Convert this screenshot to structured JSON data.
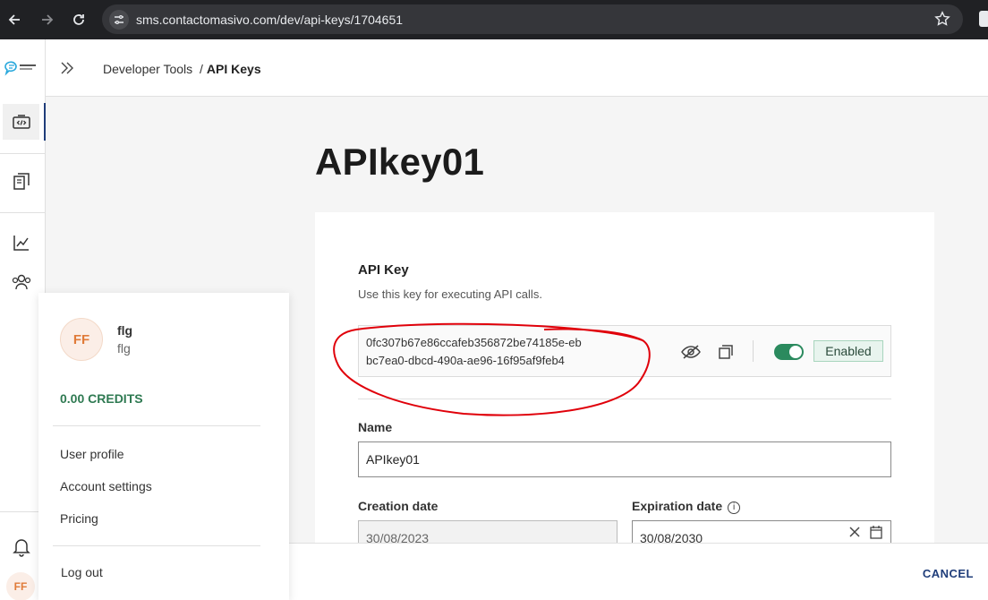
{
  "browser": {
    "url": "sms.contactomasivo.com/dev/api-keys/1704651"
  },
  "header": {
    "breadcrumb_parent": "Developer Tools",
    "breadcrumb_separator": "/",
    "breadcrumb_current": "API Keys"
  },
  "page": {
    "title": "APIkey01"
  },
  "api_key": {
    "section_title": "API Key",
    "section_description": "Use this key for executing API calls.",
    "value_line1": "0fc307b67e86ccafeb356872be74185e-eb",
    "value_line2": "bc7ea0-dbcd-490a-ae96-16f95af9feb4",
    "enabled": true,
    "status_label": "Enabled"
  },
  "form": {
    "name_label": "Name",
    "name_value": "APIkey01",
    "creation_label": "Creation date",
    "creation_value": "30/08/2023",
    "expiration_label": "Expiration date",
    "expiration_value": "30/08/2030"
  },
  "footer": {
    "cancel_label": "CANCEL"
  },
  "user_menu": {
    "initials": "FF",
    "name": "flg",
    "username": "flg",
    "credits": "0.00 CREDITS",
    "items": [
      "User profile",
      "Account settings",
      "Pricing"
    ],
    "logout_label": "Log out"
  },
  "rail": {
    "avatar_initials": "FF",
    "icons": [
      "developer-tools-icon",
      "templates-icon",
      "analytics-icon",
      "contacts-icon",
      "notifications-icon"
    ]
  },
  "colors": {
    "accent": "#1f3d7a",
    "toggle_on": "#2b8a5e",
    "credits": "#2f7a52",
    "annotation": "#e0000a"
  }
}
